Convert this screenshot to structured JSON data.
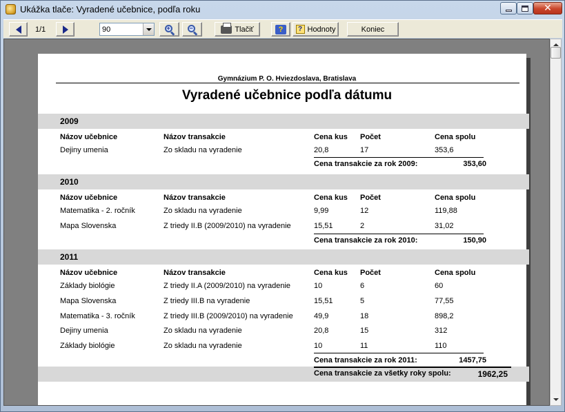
{
  "window": {
    "title": "Ukážka tlače: Vyradené učebnice, podľa roku",
    "icon": "app-icon",
    "controls": [
      "minimize-icon",
      "maximize-icon",
      "close-icon"
    ]
  },
  "toolbar": {
    "page_indicator": "1/1",
    "zoom_value": "90",
    "print_label": "Tlačiť",
    "values_label": "Hodnoty",
    "end_label": "Koniec"
  },
  "report": {
    "school": "Gymnázium P. O. Hviezdoslava, Bratislava",
    "title": "Vyradené učebnice podľa dátumu",
    "headers": {
      "book": "Názov učebnice",
      "transaction": "Názov transakcie",
      "unit_price": "Cena kus",
      "count": "Počet",
      "total_price": "Cena spolu"
    },
    "groups": [
      {
        "year": "2009",
        "rows": [
          {
            "book": "Dejiny umenia",
            "transaction": "Zo skladu na vyradenie",
            "unit_price": "20,8",
            "count": "17",
            "total_price": "353,6"
          }
        ],
        "sum_label": "Cena transakcie za rok 2009:",
        "sum_value": "353,60"
      },
      {
        "year": "2010",
        "rows": [
          {
            "book": "Matematika - 2. ročník",
            "transaction": "Zo skladu na vyradenie",
            "unit_price": "9,99",
            "count": "12",
            "total_price": "119,88"
          },
          {
            "book": "Mapa Slovenska",
            "transaction": "Z triedy II.B (2009/2010) na vyradenie",
            "unit_price": "15,51",
            "count": "2",
            "total_price": "31,02"
          }
        ],
        "sum_label": "Cena transakcie za rok 2010:",
        "sum_value": "150,90"
      },
      {
        "year": "2011",
        "rows": [
          {
            "book": "Základy biológie",
            "transaction": "Z triedy II.A (2009/2010) na vyradenie",
            "unit_price": "10",
            "count": "6",
            "total_price": "60"
          },
          {
            "book": "Mapa Slovenska",
            "transaction": "Z triedy III.B na vyradenie",
            "unit_price": "15,51",
            "count": "5",
            "total_price": "77,55"
          },
          {
            "book": "Matematika - 3. ročník",
            "transaction": "Z triedy III.B (2009/2010) na vyradenie",
            "unit_price": "49,9",
            "count": "18",
            "total_price": "898,2"
          },
          {
            "book": "Dejiny umenia",
            "transaction": "Zo skladu na vyradenie",
            "unit_price": "20,8",
            "count": "15",
            "total_price": "312"
          },
          {
            "book": "Základy biológie",
            "transaction": "Zo skladu na vyradenie",
            "unit_price": "10",
            "count": "11",
            "total_price": "110"
          }
        ],
        "sum_label": "Cena transakcie za rok 2011:",
        "sum_value": "1457,75"
      }
    ],
    "grand_total_label": "Cena transakcie za všetky roky spolu:",
    "grand_total_value": "1962,25"
  }
}
